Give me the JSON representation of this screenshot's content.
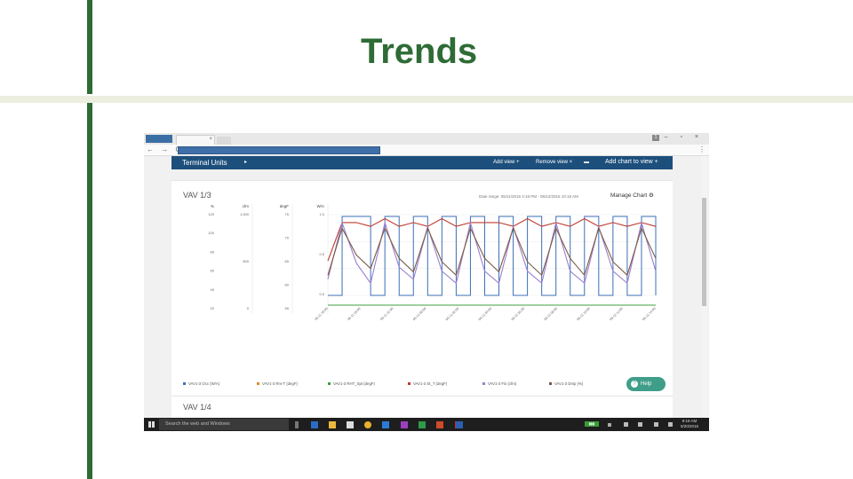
{
  "slide": {
    "title": "Trends",
    "accent": "#2e6b35"
  },
  "browser": {
    "tab_badge": "1",
    "controls": "– ▫ ×",
    "nav": "← → C",
    "menu": "⋮"
  },
  "app": {
    "header_title": "Terminal Units",
    "header_caret": "▸",
    "add_view": "Add view",
    "remove_view": "Remove view",
    "add_chart": "Add chart to view"
  },
  "card1": {
    "title": "VAV 1/3",
    "date_range": "Date range: 05/11/2016 4:18 PM - 05/12/2016 10:18 AM",
    "manage": "Manage Chart",
    "axis_units": [
      "%",
      "cfm",
      "degF",
      "W/A"
    ],
    "legend": [
      {
        "label": "VAV1-3 Occ (W/A)",
        "color": "#3b6fb6"
      },
      {
        "label": "VAV1-3 Rm-T (degF)",
        "color": "#e08a2c"
      },
      {
        "label": "VAV1-3 RHT_Spt (degF)",
        "color": "#3ea13e"
      },
      {
        "label": "VAV1-3 St_T (degF)",
        "color": "#c0392b"
      },
      {
        "label": "VAV1-3 Flo (cfm)",
        "color": "#9b7fd0"
      },
      {
        "label": "VAV1-3 Dmp (%)",
        "color": "#7a5a44"
      }
    ]
  },
  "card2": {
    "title": "VAV 1/4"
  },
  "help": {
    "label": "Help",
    "icon": "?"
  },
  "taskbar": {
    "search_placeholder": "Search the web and Windows",
    "clock_time": "9:18 AM",
    "clock_date": "5/20/2016"
  },
  "chart_data": {
    "type": "line",
    "title": "VAV 1/3",
    "axes": [
      {
        "unit": "%",
        "ticks": [
          "120",
          "100",
          "80",
          "60",
          "40",
          "20"
        ]
      },
      {
        "unit": "cfm",
        "ticks": [
          "1,000",
          "500",
          "0"
        ]
      },
      {
        "unit": "degF",
        "ticks": [
          "75",
          "70",
          "65",
          "60",
          "55"
        ]
      },
      {
        "unit": "W/A",
        "ticks": [
          "1.0",
          "0.5",
          "0.0"
        ]
      }
    ],
    "x_ticks": [
      "05-11 18:00",
      "05-11 20:00",
      "05-11 22:00",
      "05-12 00:00",
      "05-12 02:00",
      "05-12 04:00",
      "05-12 06:00",
      "05-12 08:00",
      "05-12 10:00",
      "05-12 12:00",
      "05-12 14:00"
    ],
    "grid": true,
    "legend_position": "bottom",
    "series": [
      {
        "name": "VAV1-3 Occ (W/A)",
        "values": [
          0,
          1,
          1,
          0,
          1,
          0,
          1,
          0,
          1,
          0,
          1,
          0,
          1,
          0,
          1,
          0,
          1,
          0,
          1,
          0,
          1,
          0,
          1,
          0
        ]
      },
      {
        "name": "VAV1-3 St_T (degF)",
        "values": [
          64,
          74,
          74,
          73,
          75,
          73,
          74,
          73,
          75,
          73,
          74,
          74,
          74,
          73,
          75,
          73,
          74,
          73,
          75,
          73,
          74,
          73,
          74,
          73
        ]
      },
      {
        "name": "VAV1-3 Flo (cfm)",
        "values": [
          200,
          900,
          400,
          150,
          900,
          350,
          200,
          850,
          300,
          150,
          900,
          300,
          150,
          850,
          300,
          150,
          900,
          300,
          150,
          850,
          300,
          150,
          900,
          300
        ]
      },
      {
        "name": "VAV1-3 Dmp (%)",
        "values": [
          30,
          100,
          60,
          40,
          100,
          55,
          35,
          100,
          50,
          30,
          100,
          55,
          35,
          100,
          50,
          30,
          100,
          55,
          30,
          100,
          50,
          30,
          100,
          55
        ]
      },
      {
        "name": "VAV1-3 RHT_Spt (degF)",
        "values": [
          55,
          55,
          55,
          55,
          55,
          55,
          55,
          55,
          55,
          55,
          55,
          55,
          55,
          55,
          55,
          55,
          55,
          55,
          55,
          55,
          55,
          55,
          55,
          55
        ]
      }
    ]
  }
}
